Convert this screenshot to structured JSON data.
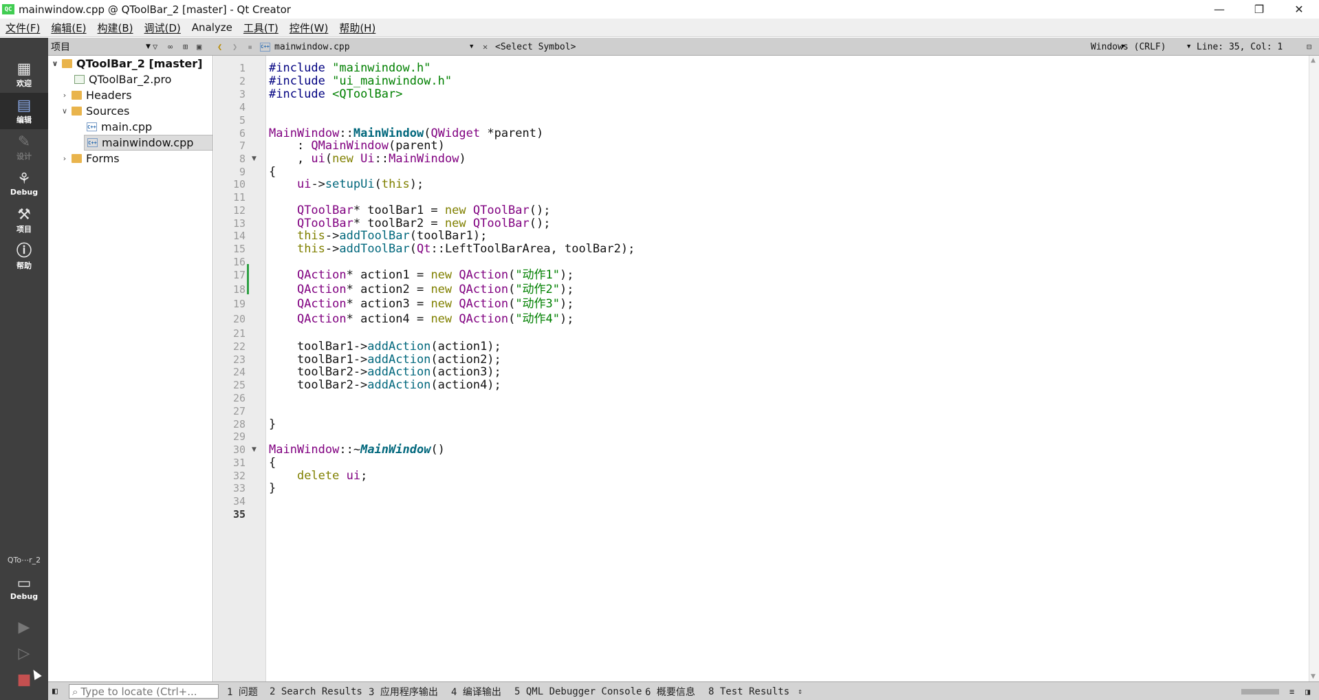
{
  "window": {
    "title": "mainwindow.cpp @ QToolBar_2 [master] - Qt Creator",
    "app_icon": "QC"
  },
  "menu": [
    "文件(F)",
    "编辑(E)",
    "构建(B)",
    "调试(D)",
    "Analyze",
    "工具(T)",
    "控件(W)",
    "帮助(H)"
  ],
  "toolbar": {
    "project_selector": "项目",
    "file_selector": "mainwindow.cpp",
    "symbol_selector": "<Select Symbol>",
    "line_ending": "Windows (CRLF)",
    "position": "Line: 35, Col: 1"
  },
  "sidebar": {
    "modes": [
      "欢迎",
      "编辑",
      "设计",
      "Debug",
      "项目",
      "帮助"
    ],
    "target_name": "QTo⋯r_2",
    "target_mode": "Debug"
  },
  "tree": {
    "root": "QToolBar_2 [master]",
    "pro": "QToolBar_2.pro",
    "headers": "Headers",
    "sources": "Sources",
    "main": "main.cpp",
    "mainwindow": "mainwindow.cpp",
    "forms": "Forms"
  },
  "editor": {
    "line_numbers": [
      "1",
      "2",
      "3",
      "4",
      "5",
      "6",
      "7",
      "8",
      "9",
      "10",
      "11",
      "12",
      "13",
      "14",
      "15",
      "16",
      "17",
      "18",
      "19",
      "20",
      "21",
      "22",
      "23",
      "24",
      "25",
      "26",
      "27",
      "28",
      "29",
      "30",
      "31",
      "32",
      "33",
      "34",
      "35"
    ],
    "current_line": "35",
    "code": [
      [
        "#include \"mainwindow.h\""
      ],
      [
        "#include \"ui_mainwindow.h\""
      ],
      [
        "#include <QToolBar>"
      ],
      [],
      [],
      [
        "MainWindow",
        "::",
        "MainWindow",
        "(",
        "QWidget",
        " *parent)"
      ],
      [
        "    : ",
        "QMainWindow",
        "(parent)"
      ],
      [
        "    , ",
        "ui",
        "(",
        "new",
        " ",
        "Ui",
        "::",
        "MainWindow",
        ")"
      ],
      [
        "{"
      ],
      [
        "    ",
        "ui",
        "->",
        "setupUi",
        "(",
        "this",
        ");"
      ],
      [],
      [
        "    ",
        "QToolBar",
        "* toolBar1 = ",
        "new",
        " ",
        "QToolBar",
        "();"
      ],
      [
        "    ",
        "QToolBar",
        "* toolBar2 = ",
        "new",
        " ",
        "QToolBar",
        "();"
      ],
      [
        "    ",
        "this",
        "->",
        "addToolBar",
        "(toolBar1);"
      ],
      [
        "    ",
        "this",
        "->",
        "addToolBar",
        "(",
        "Qt",
        "::",
        "LeftToolBarArea",
        ", toolBar2);"
      ],
      [],
      [
        "    ",
        "QAction",
        "* action1 = ",
        "new",
        " ",
        "QAction",
        "(",
        "\"动作1\"",
        ");"
      ],
      [
        "    ",
        "QAction",
        "* action2 = ",
        "new",
        " ",
        "QAction",
        "(",
        "\"动作2\"",
        ");"
      ],
      [
        "    ",
        "QAction",
        "* action3 = ",
        "new",
        " ",
        "QAction",
        "(",
        "\"动作3\"",
        ");"
      ],
      [
        "    ",
        "QAction",
        "* action4 = ",
        "new",
        " ",
        "QAction",
        "(",
        "\"动作4\"",
        ");"
      ],
      [],
      [
        "    toolBar1->",
        "addAction",
        "(action1);"
      ],
      [
        "    toolBar1->",
        "addAction",
        "(action2);"
      ],
      [
        "    toolBar2->",
        "addAction",
        "(action3);"
      ],
      [
        "    toolBar2->",
        "addAction",
        "(action4);"
      ],
      [],
      [],
      [
        "}"
      ],
      [],
      [
        "MainWindow",
        "::~",
        "MainWindow",
        "()"
      ],
      [
        "{"
      ],
      [
        "    ",
        "delete",
        " ",
        "ui",
        ";"
      ],
      [
        "}"
      ],
      [],
      []
    ]
  },
  "locator_placeholder": "Type to locate (Ctrl+...",
  "output_tabs": [
    "1 问题",
    "2 Search Results",
    "3 应用程序输出",
    "4 编译输出",
    "5 QML Debugger Console",
    "6 概要信息",
    "8 Test Results"
  ],
  "colors": {
    "sidebar": "#3f3f3f",
    "keyword": "#808000",
    "string": "#008000",
    "type": "#800080",
    "function": "#00677c"
  }
}
